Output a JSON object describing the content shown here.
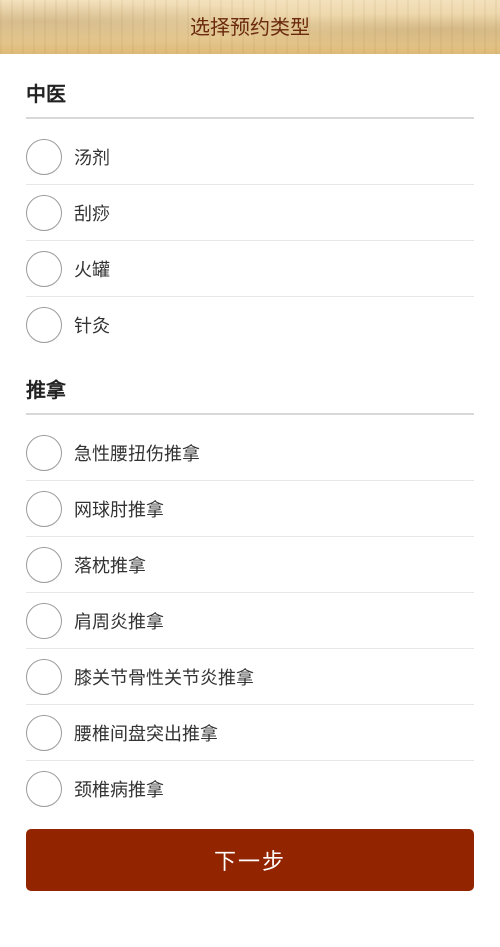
{
  "header": {
    "title": "选择预约类型"
  },
  "sections": [
    {
      "title": "中医",
      "options": [
        "汤剂",
        "刮痧",
        "火罐",
        "针灸"
      ]
    },
    {
      "title": "推拿",
      "options": [
        "急性腰扭伤推拿",
        "网球肘推拿",
        "落枕推拿",
        "肩周炎推拿",
        "膝关节骨性关节炎推拿",
        "腰椎间盘突出推拿",
        "颈椎病推拿"
      ]
    }
  ],
  "footer": {
    "next_label": "下一步"
  },
  "colors": {
    "primary": "#932400",
    "title_text": "#6b2a0e"
  }
}
